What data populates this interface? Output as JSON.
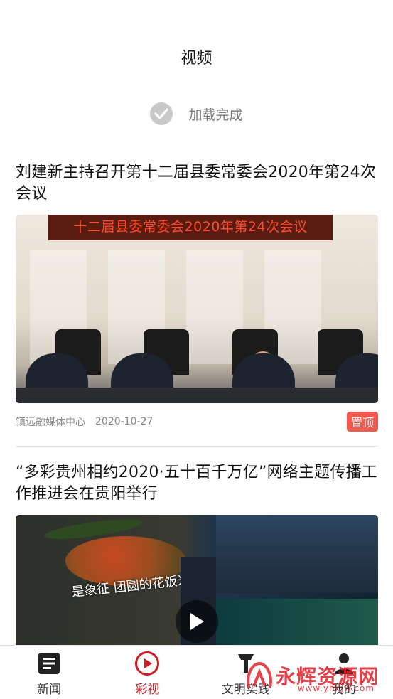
{
  "header": {
    "title": "视频"
  },
  "loading": {
    "label": "加载完成",
    "icon": "check-circle-icon"
  },
  "articles": [
    {
      "title": "刘建新主持召开第十二届县委常委会2020年第24次会议",
      "thumbnail_banner": "十二届县委常委会2020年第24次会议",
      "source": "镇远融媒体中心",
      "date": "2020-10-27",
      "badge": "置顶"
    },
    {
      "title": "“多彩贵州相约2020·五十百千万亿”网络主题传播工作推进会在贵阳举行",
      "thumbnail_text": "是象征 团圆的花饭米",
      "has_play_icon": true
    }
  ],
  "tabbar": {
    "items": [
      {
        "label": "新闻",
        "icon": "news-icon",
        "active": false
      },
      {
        "label": "彩视",
        "icon": "play-circle-icon",
        "active": true
      },
      {
        "label": "文明实践",
        "icon": "practice-icon",
        "active": false
      },
      {
        "label": "我的",
        "icon": "user-icon",
        "active": false
      }
    ]
  },
  "watermark": {
    "text": "永辉资源网",
    "url": "www.yhkjw.com"
  },
  "colors": {
    "accent": "#d11a20",
    "badge": "#f05a4f",
    "check": "#c9c9c9"
  }
}
